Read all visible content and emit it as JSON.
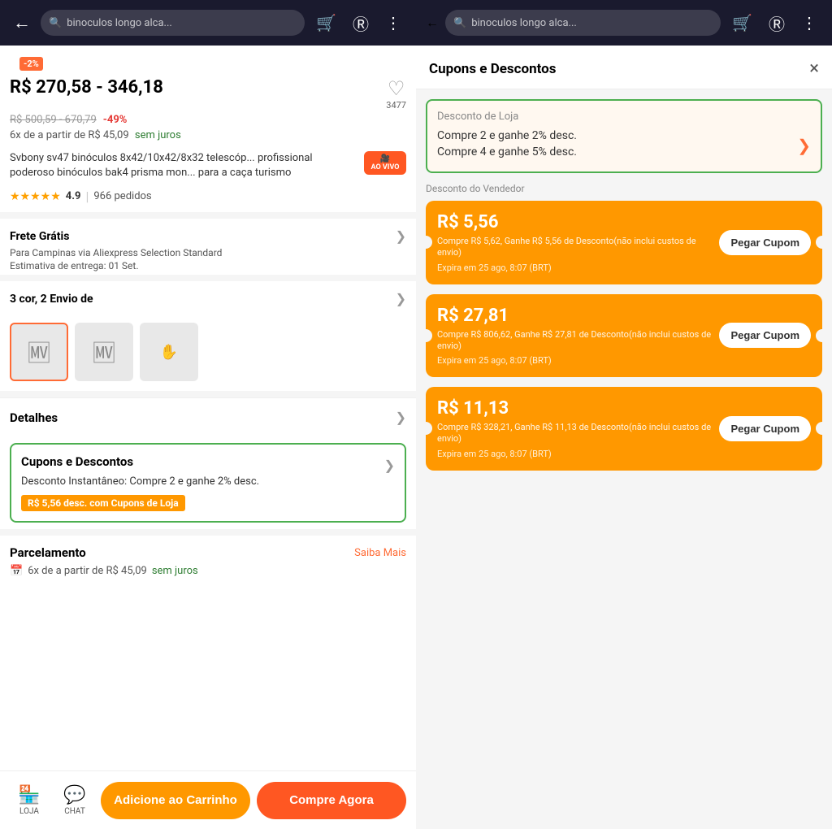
{
  "left": {
    "nav": {
      "search_placeholder": "binoculos longo alca..."
    },
    "discount_badge": "-2%",
    "price": {
      "range": "R$ 270,58 - 346,18",
      "old_range": "R$ 500,59 - 670,79",
      "discount_pct": "-49%",
      "installments": "6x de a partir de R$ 45,09",
      "sem_juros": "sem juros",
      "wishlist_count": "3477"
    },
    "product": {
      "title": "Svbony sv47 binóculos 8x42/10x42/8x32 telescóp... profissional poderoso binóculos bak4 prisma mon... para a caça turismo",
      "ao_vivo": "AO VIVO",
      "rating": "4.9",
      "orders": "966 pedidos"
    },
    "shipping": {
      "title": "Frete Grátis",
      "to": "Para Campinas via Aliexpress Selection Standard",
      "estimate": "Estimativa de entrega: 01 Set."
    },
    "variants": {
      "label": "3 cor, 2 Envio de"
    },
    "detalhes": {
      "label": "Detalhes"
    },
    "cupons": {
      "label": "Cupons e Descontos",
      "desc": "Desconto Instantâneo: Compre 2 e ganhe 2% desc.",
      "badge": "R$ 5,56 desc. com Cupons de Loja"
    },
    "parcelamento": {
      "label": "Parcelamento",
      "saiba_mais": "Saiba Mais",
      "sub": "6x de a partir de R$ 45,09",
      "sem_juros": "sem juros"
    },
    "bottom": {
      "loja_label": "LOJA",
      "chat_label": "CHAT",
      "add_btn": "Adicione ao Carrinho",
      "buy_btn": "Compre Agora"
    }
  },
  "right": {
    "nav": {
      "search_placeholder": "binoculos longo alca..."
    },
    "modal": {
      "title": "Cupons e Descontos",
      "close": "×",
      "loja_section": {
        "header": "Desconto de Loja",
        "deal1": "Compre 2 e ganhe 2% desc.",
        "deal2": "Compre 4 e ganhe 5% desc."
      },
      "vendedor_label": "Desconto do Vendedor",
      "coupons": [
        {
          "amount": "R$ 5,56",
          "desc": "Compre R$ 5,62, Ganhe R$ 5,56 de\nDesconto(não inclui custos de envio)",
          "expiry": "Expira em 25 ago, 8:07 (BRT)",
          "btn_label": "Pegar Cupom"
        },
        {
          "amount": "R$ 27,81",
          "desc": "Compre R$ 806,62, Ganhe R$ 27,81 de\nDesconto(não inclui custos de envio)",
          "expiry": "Expira em 25 ago, 8:07 (BRT)",
          "btn_label": "Pegar Cupom"
        },
        {
          "amount": "R$ 11,13",
          "desc": "Compre R$ 328,21, Ganhe R$ 11,13 de\nDesconto(não inclui custos de envio)",
          "expiry": "Expira em 25 ago, 8:07 (BRT)",
          "btn_label": "Pegar Cupom"
        }
      ]
    }
  }
}
